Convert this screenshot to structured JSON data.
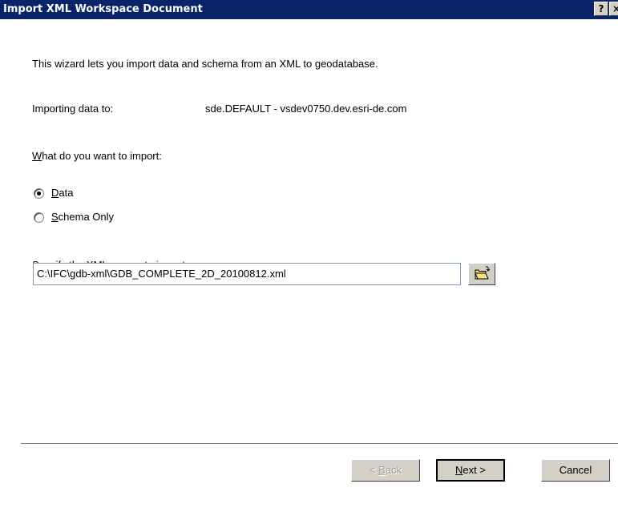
{
  "window": {
    "title": "Import XML Workspace Document",
    "help_label": "?",
    "close_label": "×"
  },
  "intro": "This wizard lets you import data and schema from an XML to geodatabase.",
  "importing": {
    "label": "Importing data to:",
    "value": "sde.DEFAULT - vsdev0750.dev.esri-de.com"
  },
  "question": {
    "accel": "W",
    "rest": "hat do you want to import:"
  },
  "options": [
    {
      "accel": "D",
      "rest": "ata",
      "selected": true
    },
    {
      "accel": "S",
      "rest": "chema Only",
      "selected": false
    }
  ],
  "source": {
    "pre": "S",
    "accel": "p",
    "rest": "ecify the XML source to import:",
    "value": "C:\\IFC\\gdb-xml\\GDB_COMPLETE_2D_20100812.xml"
  },
  "buttons": {
    "back": {
      "arrow": "< ",
      "accel": "B",
      "rest": "ack"
    },
    "next": {
      "accel": "N",
      "rest": "ext >"
    },
    "cancel": "Cancel"
  },
  "icons": {
    "browse": "open-folder-icon"
  }
}
